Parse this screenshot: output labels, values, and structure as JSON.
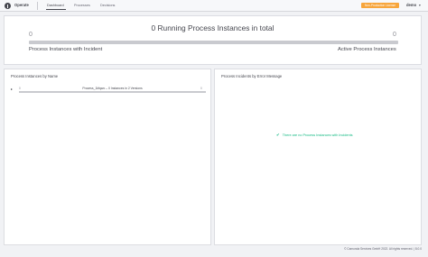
{
  "header": {
    "app_name": "Operate",
    "nav": [
      {
        "label": "Dashboard",
        "active": true
      },
      {
        "label": "Processes",
        "active": false
      },
      {
        "label": "Decisions",
        "active": false
      }
    ],
    "env_badge": "Non-Production License",
    "user": "demo",
    "user_chevron": "▾",
    "logo_icon": "operate-logo-icon"
  },
  "summary": {
    "title": "0 Running Process Instances in total",
    "incident_count": "0",
    "active_count": "0",
    "incident_label": "Process Instances with Incident",
    "active_label": "Active Process Instances",
    "incident_fraction": 0
  },
  "left_panel": {
    "title": "Process Instances by Name",
    "rows": [
      {
        "chevron": "▸",
        "left_count": "0",
        "label": "Process_1kfqwo – 0 Instances in 2 Versions",
        "right_count": "0",
        "incident_fraction": 0
      }
    ]
  },
  "right_panel": {
    "title": "Process Incidents by Error Message",
    "empty_message": "There are no Process Instances with Incidents",
    "check_glyph": "✔"
  },
  "footer": {
    "copyright": "© Camunda Services GmbH 2022. All rights reserved. | 8.0.0"
  },
  "colors": {
    "incident": "#ff3d3d",
    "success": "#10b981",
    "badge": "#f7a53b"
  }
}
